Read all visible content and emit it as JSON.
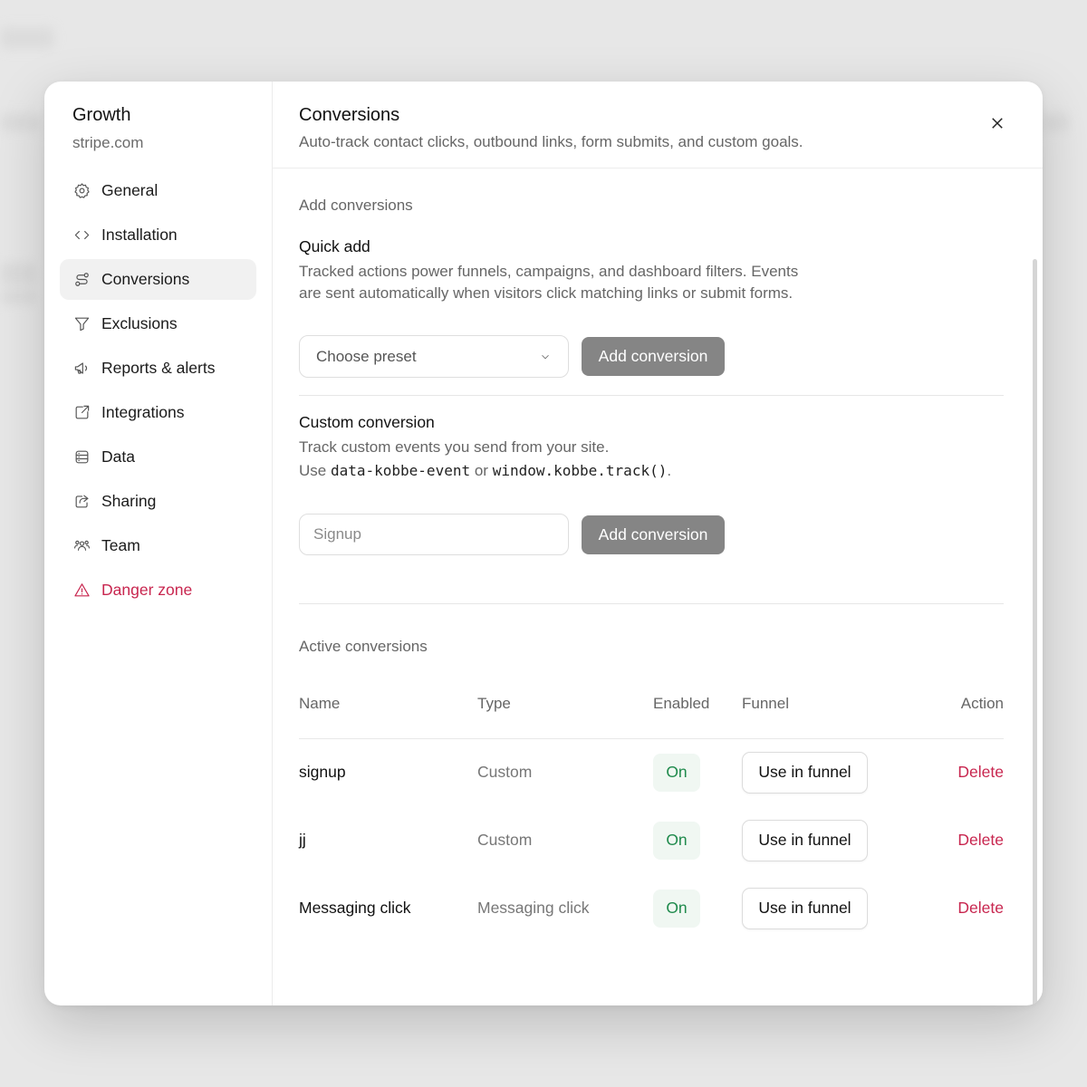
{
  "colors": {
    "accent_danger": "#c8264f",
    "on_badge_text": "#1f8a4c",
    "on_badge_bg": "#f0f7f2",
    "primary_button_bg": "#858585"
  },
  "sidebar": {
    "site_name": "Growth",
    "site_domain": "stripe.com",
    "items": [
      {
        "label": "General",
        "icon": "gear-icon"
      },
      {
        "label": "Installation",
        "icon": "code-icon"
      },
      {
        "label": "Conversions",
        "icon": "route-icon",
        "active": true
      },
      {
        "label": "Exclusions",
        "icon": "filter-icon"
      },
      {
        "label": "Reports & alerts",
        "icon": "megaphone-icon"
      },
      {
        "label": "Integrations",
        "icon": "external-link-icon"
      },
      {
        "label": "Data",
        "icon": "database-icon"
      },
      {
        "label": "Sharing",
        "icon": "share-icon"
      },
      {
        "label": "Team",
        "icon": "users-icon"
      },
      {
        "label": "Danger zone",
        "icon": "warning-icon",
        "danger": true
      }
    ]
  },
  "header": {
    "title": "Conversions",
    "subtitle": "Auto-track contact clicks, outbound links, form submits, and custom goals."
  },
  "add_section": {
    "label": "Add conversions",
    "quick_add": {
      "title": "Quick add",
      "description_line1": "Tracked actions power funnels, campaigns, and dashboard filters. Events",
      "description_line2": "are sent automatically when visitors click matching links or submit forms.",
      "select_value": "Choose preset",
      "button_label": "Add conversion"
    },
    "custom": {
      "title": "Custom conversion",
      "description_line1": "Track custom events you send from your site.",
      "use_prefix": "Use",
      "code_attr": "data-kobbe-event",
      "or_text": "or",
      "code_fn": "window.kobbe.track()",
      "period": ".",
      "input_placeholder": "Signup",
      "button_label": "Add conversion"
    }
  },
  "active_section": {
    "label": "Active conversions",
    "columns": {
      "name": "Name",
      "type": "Type",
      "enabled": "Enabled",
      "funnel": "Funnel",
      "action": "Action"
    },
    "rows": [
      {
        "name": "signup",
        "type": "Custom",
        "enabled": "On",
        "funnel": "Use in funnel",
        "action": "Delete"
      },
      {
        "name": "jj",
        "type": "Custom",
        "enabled": "On",
        "funnel": "Use in funnel",
        "action": "Delete"
      },
      {
        "name": "Messaging click",
        "type": "Messaging click",
        "enabled": "On",
        "funnel": "Use in funnel",
        "action": "Delete"
      }
    ]
  }
}
